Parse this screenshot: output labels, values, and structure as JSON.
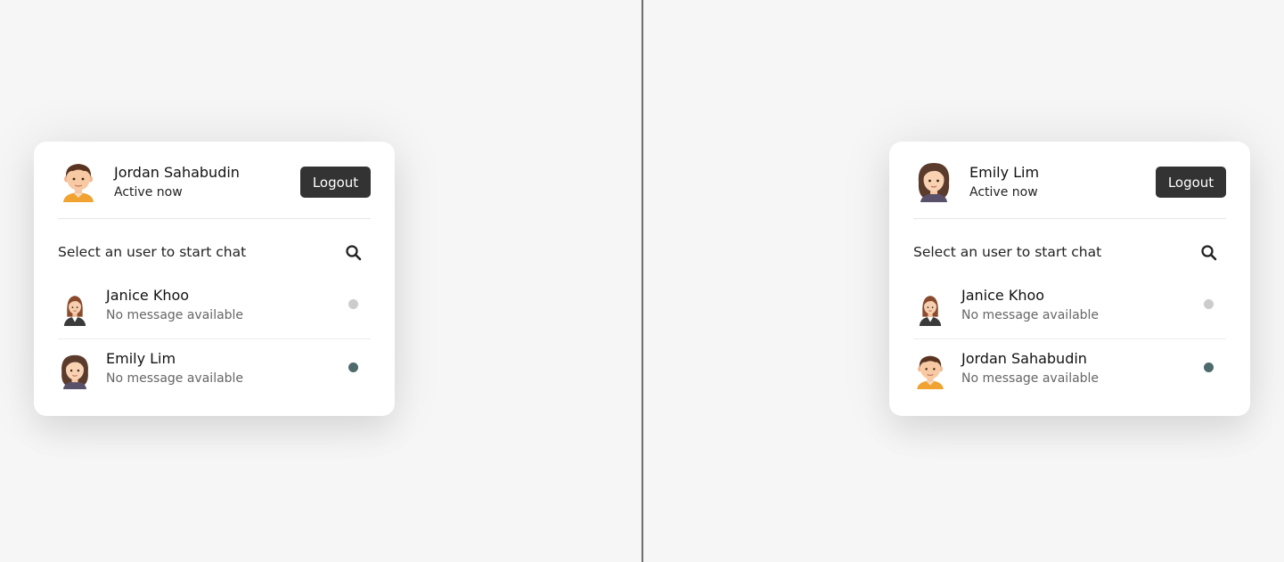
{
  "colors": {
    "page_bg": "#f6f6f6",
    "logout_bg": "#333333",
    "online_dot": "#4f6a6b",
    "offline_dot": "#cccccc"
  },
  "left": {
    "header": {
      "name": "Jordan Sahabudin",
      "status": "Active now",
      "avatar_icon": "male-avatar-icon",
      "logout_label": "Logout"
    },
    "search": {
      "prompt": "Select an user to start chat",
      "icon": "search-icon"
    },
    "users": [
      {
        "name": "Janice Khoo",
        "message": "No message available",
        "avatar_icon": "businesswoman-avatar-icon",
        "status": "offline"
      },
      {
        "name": "Emily Lim",
        "message": "No message available",
        "avatar_icon": "female-avatar-icon",
        "status": "online"
      }
    ]
  },
  "right": {
    "header": {
      "name": "Emily Lim",
      "status": "Active now",
      "avatar_icon": "female-avatar-icon",
      "logout_label": "Logout"
    },
    "search": {
      "prompt": "Select an user to start chat",
      "icon": "search-icon"
    },
    "users": [
      {
        "name": "Janice Khoo",
        "message": "No message available",
        "avatar_icon": "businesswoman-avatar-icon",
        "status": "offline"
      },
      {
        "name": "Jordan Sahabudin",
        "message": "No message available",
        "avatar_icon": "male-avatar-icon",
        "status": "online"
      }
    ]
  }
}
